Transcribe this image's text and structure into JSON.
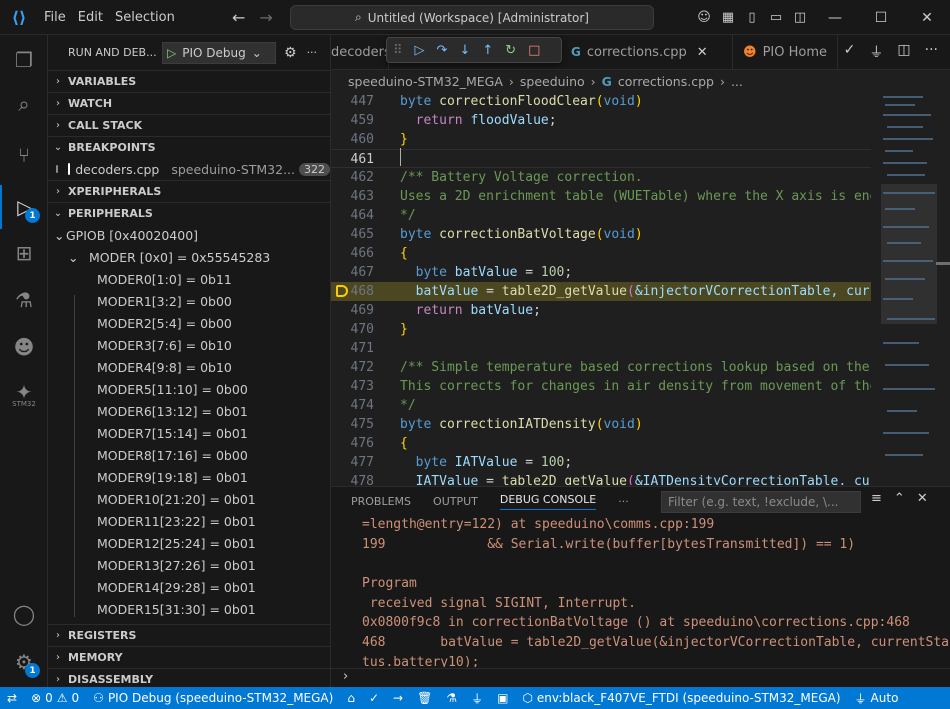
{
  "titlebar": {
    "menu": [
      "File",
      "Edit",
      "Selection"
    ],
    "search_text": "Untitled (Workspace) [Administrator]"
  },
  "sidebar": {
    "title": "RUN AND DEB...",
    "config_label": "PIO Debug",
    "sections": {
      "variables": "VARIABLES",
      "watch": "WATCH",
      "callstack": "CALL STACK",
      "breakpoints": "BREAKPOINTS",
      "xperipherals": "XPERIPHERALS",
      "peripherals": "PERIPHERALS",
      "registers": "REGISTERS",
      "memory": "MEMORY",
      "disassembly": "DISASSEMBLY"
    },
    "breakpoint": {
      "file": "decoders.cpp",
      "path": "speeduino-STM32...",
      "line": "322"
    },
    "gpio": "GPIOB  [0x40020400]",
    "moder": "MODER [0x0] = 0x55545283",
    "registers": [
      "MODER0[1:0] = 0b11",
      "MODER1[3:2] = 0b00",
      "MODER2[5:4] = 0b00",
      "MODER3[7:6] = 0b10",
      "MODER4[9:8] = 0b10",
      "MODER5[11:10] = 0b00",
      "MODER6[13:12] = 0b01",
      "MODER7[15:14] = 0b01",
      "MODER8[17:16] = 0b00",
      "MODER9[19:18] = 0b01",
      "MODER10[21:20] = 0b01",
      "MODER11[23:22] = 0b01",
      "MODER12[25:24] = 0b01",
      "MODER13[27:26] = 0b01",
      "MODER14[29:28] = 0b01",
      "MODER15[31:30] = 0b01"
    ]
  },
  "activity": {
    "debug_badge": "1",
    "settings_badge": "1",
    "stm32_label": "STM32"
  },
  "tabs": {
    "decoders": "decoders.cpp",
    "corrections": "corrections.cpp",
    "pio_home": "PIO Home"
  },
  "breadcrumb": [
    "speeduino-STM32_MEGA",
    "speeduino",
    "corrections.cpp",
    "..."
  ],
  "code": {
    "line_numbers": [
      "447",
      "459",
      "460",
      "461",
      "462",
      "463",
      "464",
      "465",
      "466",
      "467",
      "468",
      "469",
      "470",
      "471",
      "472",
      "473",
      "474",
      "475",
      "476",
      "477",
      "478"
    ],
    "comments": [
      "/** Battery Voltage correction.",
      "Uses a 2D enrichment table (WUETable) where the X axis is eng",
      "*/",
      "/** Simple temperature based corrections lookup based on the",
      "This corrects for changes in air density from movement of the",
      "*/"
    ],
    "tokens": {
      "byte": "byte",
      "void": "void",
      "return": "return",
      "fn_flood": "correctionFloodClear",
      "fn_bat": "correctionBatVoltage",
      "fn_iat": "correctionIATDensity",
      "fn_table": "table2D_getValue",
      "var_flood": "floodValue",
      "var_bat": "batValue",
      "var_iat": "IATValue",
      "table_bat": "&injectorVCorrectionTable, curr",
      "table_iat": "&IATDensityCorrectionTable, curr",
      "num_100": "100"
    }
  },
  "panel": {
    "tabs": [
      "PROBLEMS",
      "OUTPUT",
      "DEBUG CONSOLE"
    ],
    "filter_placeholder": "Filter (e.g. text, !exclude, \\...",
    "console_lines": [
      "=length@entry=122) at speeduino\\comms.cpp:199",
      "199             && Serial.write(buffer[bytesTransmitted]) == 1)",
      "",
      "Program",
      " received signal SIGINT, Interrupt.",
      "0x0800f9c8 in correctionBatVoltage () at speeduino\\corrections.cpp:468",
      "468       batValue = table2D_getValue(&injectorVCorrectionTable, currentSta",
      "tus.battery10);"
    ]
  },
  "status": {
    "errors": "0",
    "warnings": "0",
    "debug": "PIO Debug (speeduino-STM32_MEGA)",
    "env": "env:black_F407VE_FTDI (speeduino-STM32_MEGA)",
    "auto": "Auto"
  }
}
